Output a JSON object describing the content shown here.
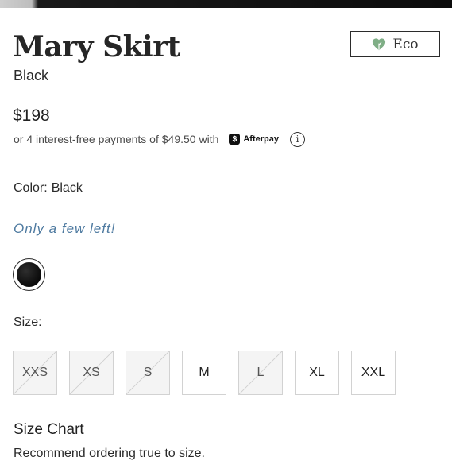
{
  "product": {
    "title": "Mary Skirt",
    "color_name": "Black",
    "badge": {
      "label": "Eco",
      "icon": "heart-leaf-icon",
      "icon_color": "#7fae86"
    }
  },
  "pricing": {
    "price": "$198",
    "installments_text": "or 4 interest-free payments of $49.50 with",
    "provider": "Afterpay",
    "provider_mark": "$",
    "info_icon": "info-icon"
  },
  "color_selector": {
    "label": "Color:",
    "selected": "Black",
    "stock_note": "Only a few left!",
    "stock_note_color": "#4e7aa0",
    "swatches": [
      {
        "name": "Black",
        "hex": "#111111",
        "selected": true
      }
    ]
  },
  "size_selector": {
    "label": "Size:",
    "options": [
      {
        "label": "XXS",
        "available": false
      },
      {
        "label": "XS",
        "available": false
      },
      {
        "label": "S",
        "available": false
      },
      {
        "label": "M",
        "available": true
      },
      {
        "label": "L",
        "available": false
      },
      {
        "label": "XL",
        "available": true
      },
      {
        "label": "XXL",
        "available": true
      }
    ],
    "size_chart_link": "Size Chart",
    "fit_note": "Recommend ordering true to size."
  }
}
